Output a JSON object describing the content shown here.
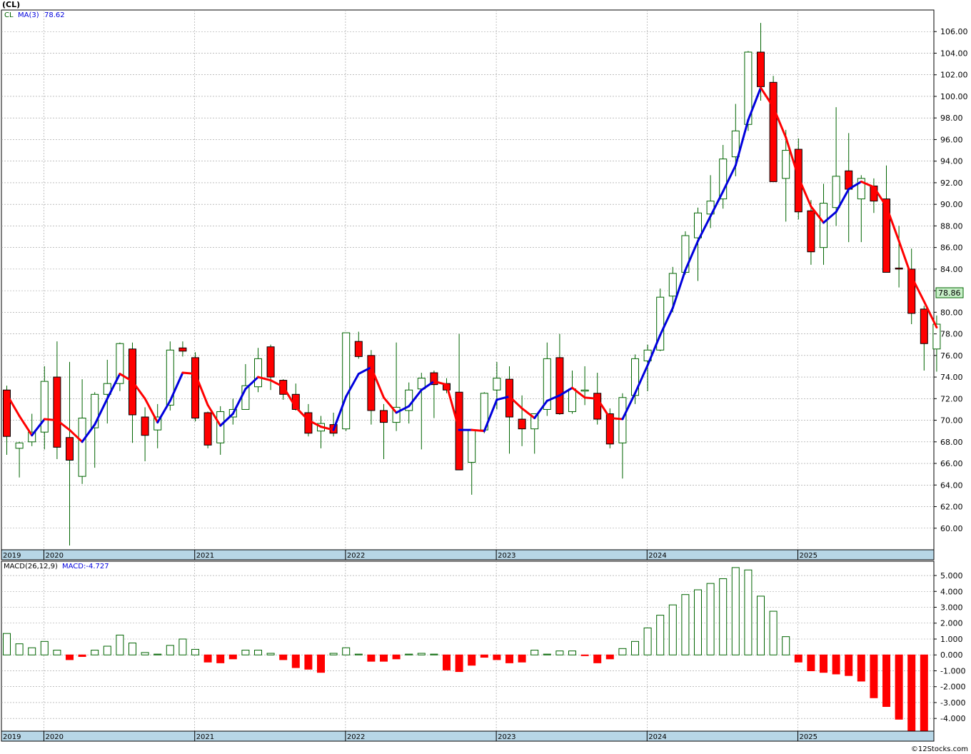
{
  "title": "(CL)",
  "watermark": "©12Stocks.com",
  "legend_price": {
    "symbol": "CL",
    "ma_label": "MA(3)",
    "ma_value": "78.62"
  },
  "legend_macd": {
    "label": "MACD(26,12,9)",
    "value": "MACD:-4.727"
  },
  "last_price_label": "78.86",
  "colors": {
    "up": "#006400",
    "down": "#ff0000",
    "ma_rising": "#0000dd",
    "ma_falling": "#ff0000",
    "axis_band": "#b7d6e6",
    "grid": "#999999",
    "price_tag_bg": "#c8f0c8"
  },
  "chart_data": [
    {
      "type": "candlestick",
      "title": "(CL)",
      "ylim": [
        58,
        108
      ],
      "yticks": [
        60,
        62,
        64,
        66,
        68,
        70,
        72,
        74,
        76,
        78,
        80,
        82,
        84,
        86,
        88,
        90,
        92,
        94,
        96,
        98,
        100,
        102,
        104,
        106
      ],
      "ytick_labels": [
        "60.00",
        "62.00",
        "64.00",
        "66.00",
        "68.00",
        "70.00",
        "72.00",
        "74.00",
        "76.00",
        "78.00",
        "80.00",
        "82.00",
        "84.00",
        "86.00",
        "88.00",
        "90.00",
        "92.00",
        "94.00",
        "96.00",
        "98.00",
        "100.00",
        "102.00",
        "104.00",
        "106.00"
      ],
      "year_labels": [
        "2019",
        "2020",
        "2021",
        "2022",
        "2023",
        "2024",
        "2025"
      ],
      "year_positions": [
        0,
        3,
        15,
        27,
        39,
        51,
        63
      ],
      "candles": [
        {
          "o": 72.8,
          "h": 73.2,
          "l": 66.8,
          "c": 68.5
        },
        {
          "o": 67.4,
          "h": 68.0,
          "l": 64.7,
          "c": 67.9
        },
        {
          "o": 68.0,
          "h": 70.6,
          "l": 67.6,
          "c": 68.9
        },
        {
          "o": 68.9,
          "h": 75.0,
          "l": 67.3,
          "c": 73.6
        },
        {
          "o": 74.0,
          "h": 77.3,
          "l": 66.4,
          "c": 67.5
        },
        {
          "o": 68.4,
          "h": 75.4,
          "l": 58.4,
          "c": 66.3
        },
        {
          "o": 64.8,
          "h": 73.8,
          "l": 64.1,
          "c": 70.2
        },
        {
          "o": 69.3,
          "h": 72.6,
          "l": 65.6,
          "c": 72.4
        },
        {
          "o": 72.4,
          "h": 75.6,
          "l": 69.7,
          "c": 73.4
        },
        {
          "o": 73.4,
          "h": 77.2,
          "l": 72.7,
          "c": 77.1
        },
        {
          "o": 76.6,
          "h": 77.2,
          "l": 67.9,
          "c": 70.5
        },
        {
          "o": 70.3,
          "h": 71.2,
          "l": 66.2,
          "c": 68.6
        },
        {
          "o": 69.1,
          "h": 71.5,
          "l": 67.4,
          "c": 70.3
        },
        {
          "o": 71.4,
          "h": 77.3,
          "l": 70.9,
          "c": 76.5
        },
        {
          "o": 76.7,
          "h": 77.3,
          "l": 75.9,
          "c": 76.4
        },
        {
          "o": 75.8,
          "h": 76.3,
          "l": 69.9,
          "c": 70.2
        },
        {
          "o": 70.7,
          "h": 70.8,
          "l": 67.4,
          "c": 67.7
        },
        {
          "o": 67.9,
          "h": 71.3,
          "l": 66.8,
          "c": 70.8
        },
        {
          "o": 70.3,
          "h": 72.0,
          "l": 69.6,
          "c": 71.0
        },
        {
          "o": 71.0,
          "h": 75.2,
          "l": 71.0,
          "c": 73.2
        },
        {
          "o": 73.1,
          "h": 76.7,
          "l": 72.6,
          "c": 75.7
        },
        {
          "o": 76.8,
          "h": 77.0,
          "l": 72.8,
          "c": 74.0
        },
        {
          "o": 73.7,
          "h": 73.8,
          "l": 71.9,
          "c": 72.4
        },
        {
          "o": 72.4,
          "h": 73.4,
          "l": 70.9,
          "c": 71.0
        },
        {
          "o": 70.7,
          "h": 71.5,
          "l": 68.5,
          "c": 68.8
        },
        {
          "o": 69.0,
          "h": 70.4,
          "l": 67.4,
          "c": 69.7
        },
        {
          "o": 69.6,
          "h": 70.7,
          "l": 68.5,
          "c": 68.8
        },
        {
          "o": 69.2,
          "h": 78.1,
          "l": 69.0,
          "c": 78.1
        },
        {
          "o": 77.3,
          "h": 78.2,
          "l": 75.7,
          "c": 75.9
        },
        {
          "o": 76.0,
          "h": 76.5,
          "l": 69.6,
          "c": 70.9
        },
        {
          "o": 70.9,
          "h": 71.5,
          "l": 66.4,
          "c": 69.8
        },
        {
          "o": 69.8,
          "h": 77.2,
          "l": 69.0,
          "c": 71.2
        },
        {
          "o": 70.9,
          "h": 73.5,
          "l": 69.7,
          "c": 72.8
        },
        {
          "o": 72.9,
          "h": 74.4,
          "l": 67.3,
          "c": 73.9
        },
        {
          "o": 74.4,
          "h": 74.6,
          "l": 70.2,
          "c": 73.3
        },
        {
          "o": 73.4,
          "h": 73.9,
          "l": 72.5,
          "c": 72.8
        },
        {
          "o": 72.6,
          "h": 78.0,
          "l": 70.5,
          "c": 65.4
        },
        {
          "o": 66.1,
          "h": 68.0,
          "l": 63.1,
          "c": 69.1
        },
        {
          "o": 69.1,
          "h": 72.6,
          "l": 68.8,
          "c": 72.5
        },
        {
          "o": 72.8,
          "h": 75.4,
          "l": 71.0,
          "c": 73.9
        },
        {
          "o": 73.8,
          "h": 75.0,
          "l": 66.9,
          "c": 70.3
        },
        {
          "o": 70.1,
          "h": 72.3,
          "l": 67.6,
          "c": 69.2
        },
        {
          "o": 69.2,
          "h": 70.4,
          "l": 66.9,
          "c": 70.6
        },
        {
          "o": 71.0,
          "h": 77.2,
          "l": 70.4,
          "c": 75.7
        },
        {
          "o": 75.8,
          "h": 78.0,
          "l": 70.5,
          "c": 70.6
        },
        {
          "o": 70.8,
          "h": 74.6,
          "l": 70.6,
          "c": 72.9
        },
        {
          "o": 72.7,
          "h": 75.0,
          "l": 71.4,
          "c": 72.8
        },
        {
          "o": 72.5,
          "h": 74.4,
          "l": 69.6,
          "c": 70.1
        },
        {
          "o": 70.6,
          "h": 71.1,
          "l": 67.4,
          "c": 67.8
        },
        {
          "o": 67.9,
          "h": 72.5,
          "l": 64.6,
          "c": 72.1
        },
        {
          "o": 72.3,
          "h": 76.1,
          "l": 71.5,
          "c": 75.7
        },
        {
          "o": 75.5,
          "h": 77.0,
          "l": 72.7,
          "c": 76.5
        },
        {
          "o": 76.5,
          "h": 82.2,
          "l": 76.4,
          "c": 81.4
        },
        {
          "o": 81.5,
          "h": 84.2,
          "l": 80.0,
          "c": 83.6
        },
        {
          "o": 83.7,
          "h": 87.5,
          "l": 83.5,
          "c": 87.1
        },
        {
          "o": 86.9,
          "h": 89.7,
          "l": 82.9,
          "c": 89.2
        },
        {
          "o": 89.1,
          "h": 92.7,
          "l": 87.8,
          "c": 90.3
        },
        {
          "o": 90.5,
          "h": 95.5,
          "l": 89.6,
          "c": 94.2
        },
        {
          "o": 94.4,
          "h": 99.3,
          "l": 92.6,
          "c": 96.8
        },
        {
          "o": 97.4,
          "h": 104.2,
          "l": 96.8,
          "c": 104.1
        },
        {
          "o": 104.1,
          "h": 106.8,
          "l": 99.6,
          "c": 100.9
        },
        {
          "o": 101.3,
          "h": 101.9,
          "l": 92.1,
          "c": 92.1
        },
        {
          "o": 92.4,
          "h": 96.9,
          "l": 88.4,
          "c": 95.0
        },
        {
          "o": 95.1,
          "h": 96.1,
          "l": 88.6,
          "c": 89.3
        },
        {
          "o": 89.4,
          "h": 90.4,
          "l": 84.4,
          "c": 85.6
        },
        {
          "o": 86.0,
          "h": 91.9,
          "l": 84.4,
          "c": 90.1
        },
        {
          "o": 89.7,
          "h": 99.0,
          "l": 88.0,
          "c": 92.6
        },
        {
          "o": 93.1,
          "h": 96.6,
          "l": 86.5,
          "c": 91.4
        },
        {
          "o": 90.5,
          "h": 92.7,
          "l": 86.5,
          "c": 92.4
        },
        {
          "o": 91.7,
          "h": 92.4,
          "l": 89.2,
          "c": 90.3
        },
        {
          "o": 90.5,
          "h": 93.6,
          "l": 83.7,
          "c": 83.7
        },
        {
          "o": 84.1,
          "h": 88.0,
          "l": 82.3,
          "c": 84.0
        },
        {
          "o": 84.0,
          "h": 85.9,
          "l": 78.9,
          "c": 79.9
        },
        {
          "o": 80.3,
          "h": 80.6,
          "l": 74.6,
          "c": 77.1
        },
        {
          "o": 76.6,
          "h": 79.7,
          "l": 74.5,
          "c": 78.9
        }
      ],
      "ma3": [
        72.4,
        70.4,
        68.6,
        70.1,
        70.0,
        69.1,
        68.0,
        69.6,
        72.0,
        74.3,
        73.6,
        72.0,
        69.8,
        71.8,
        74.4,
        74.3,
        71.4,
        69.5,
        70.6,
        72.9,
        74.0,
        73.7,
        73.1,
        71.2,
        70.0,
        69.4,
        69.1,
        72.2,
        74.3,
        74.9,
        72.1,
        70.7,
        71.3,
        72.8,
        73.6,
        73.3,
        69.1,
        69.1,
        69.0,
        71.9,
        72.2,
        71.1,
        70.2,
        71.8,
        72.3,
        73.0,
        72.1,
        72.0,
        70.2,
        70.1,
        72.5,
        75.1,
        77.9,
        80.4,
        83.9,
        86.6,
        88.9,
        91.2,
        93.6,
        97.8,
        100.8,
        99.0,
        96.2,
        92.5,
        89.8,
        88.3,
        89.3,
        91.4,
        92.1,
        91.6,
        89.8,
        86.6,
        83.3,
        81.0,
        78.6
      ]
    },
    {
      "type": "bar",
      "title": "MACD(26,12,9)",
      "ylim": [
        -4.8,
        5.9
      ],
      "yticks": [
        -4,
        -3,
        -2,
        -1,
        0,
        1,
        2,
        3,
        4,
        5
      ],
      "ytick_labels": [
        "-4.000",
        "-3.000",
        "-2.000",
        "-1.000",
        "0.000",
        "1.000",
        "2.000",
        "3.000",
        "4.000",
        "5.000"
      ],
      "year_labels": [
        "2019",
        "2020",
        "2021",
        "2022",
        "2023",
        "2024",
        "2025"
      ],
      "year_positions": [
        0,
        3,
        15,
        27,
        39,
        51,
        63
      ],
      "values": [
        1.35,
        0.7,
        0.45,
        0.85,
        0.3,
        -0.3,
        -0.1,
        0.3,
        0.55,
        1.25,
        0.75,
        0.15,
        0.05,
        0.6,
        1.0,
        0.35,
        -0.45,
        -0.5,
        -0.25,
        0.3,
        0.3,
        0.1,
        -0.3,
        -0.8,
        -0.9,
        -1.1,
        0.1,
        0.45,
        0.05,
        -0.4,
        -0.4,
        -0.25,
        0.05,
        0.1,
        0.05,
        -0.95,
        -1.05,
        -0.65,
        -0.15,
        -0.3,
        -0.5,
        -0.45,
        0.3,
        0.05,
        0.25,
        0.25,
        -0.05,
        -0.5,
        -0.25,
        0.4,
        0.85,
        1.7,
        2.5,
        3.15,
        3.8,
        4.1,
        4.5,
        4.8,
        5.5,
        5.35,
        3.7,
        2.75,
        1.15,
        -0.45,
        -1.0,
        -1.1,
        -1.2,
        -1.3,
        -1.65,
        -2.7,
        -3.25,
        -4.05,
        -4.8,
        -4.8
      ]
    }
  ]
}
